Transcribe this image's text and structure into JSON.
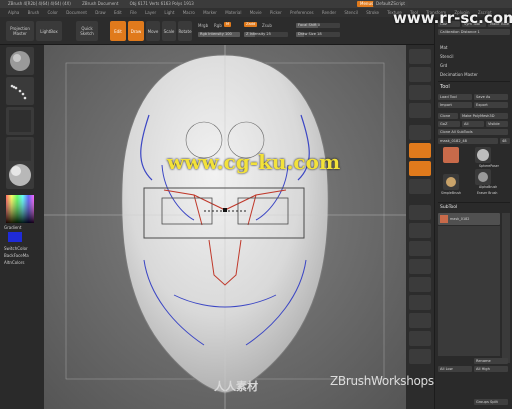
{
  "titlebar": {
    "items": [
      "ZBrush 4[R2b] 4(64) 4(64) (4X)",
      "ZBrush Document",
      "Obj 6171 Verts 6163 Polys 1913"
    ],
    "menu_button": "Menus",
    "script_button": "DefaultZScript"
  },
  "menubar": {
    "items": [
      "Alpha",
      "Brush",
      "Color",
      "Document",
      "Draw",
      "Edit",
      "File",
      "Layer",
      "Light",
      "Macro",
      "Marker",
      "Material",
      "Movie",
      "Picker",
      "Preferences",
      "Render",
      "Stencil",
      "Stroke",
      "Texture",
      "Tool",
      "Transform",
      "Zplugin",
      "Zscript"
    ]
  },
  "toolbar": {
    "projection_master": "Projection Master",
    "lightbox": "LightBox",
    "quick_sketch": "Quick Sketch",
    "edit": "Edit",
    "draw": "Draw",
    "move": "Move",
    "scale": "Scale",
    "rotate": "Rotate",
    "mrgb": "Mrgb",
    "rgb": "Rgb",
    "m": "M",
    "rgb_intensity": "Rgb Intensity 100",
    "zadd": "Zadd",
    "zsub": "Zsub",
    "z_intensity": "Z Intensity 25",
    "focal_shift": "Focal Shift 0",
    "draw_size": "Draw Size 18",
    "rgb_intensity_value": 100,
    "z_intensity_value": 25,
    "focal_shift_value": 0,
    "draw_size_value": 18
  },
  "left_tray": {
    "gradient": "Gradient",
    "switch_color": "SwitchColor",
    "backface_mask": "BackFaceMa",
    "alternate": "AltnColors"
  },
  "canvas": {
    "watermark": "www.cg-ku.com",
    "brand": "ZBrushWorkshops",
    "site": "www.rr-sc.com",
    "cn_logo": "人人素材"
  },
  "palette": {
    "top_buttons": [
      "Goz",
      "Load",
      "Save"
    ],
    "row1": [
      "Goz",
      "Sym Tool",
      "Make Tube"
    ],
    "calibration": "Calibration Distance 1",
    "sections": [
      "Mat",
      "Stencil",
      "Grd",
      "Decimation Master"
    ],
    "tool_header": "Tool",
    "load_tool": "Load Tool",
    "save_as": "Save As",
    "import": "Import",
    "export": "Export",
    "clone": "Clone",
    "make_polymesh": "Make PolyMesh3D",
    "goz": "GoZ",
    "all": "All",
    "visible": "Visible",
    "clone_all_subtools": "Clone All SubTools",
    "tool_name": "mask_0182_48",
    "tool_count": "48",
    "thumb_labels": [
      "SimpleBrush",
      "Eraser Brush",
      "SpherePoser",
      "AlphaBrush"
    ],
    "subtool_header": "SubTool",
    "subtool_name": "mask_0182",
    "rename": "Rename",
    "all_low": "All Low",
    "all_high": "All High",
    "groups_split": "Groups Split"
  },
  "colors": {
    "accent": "#e07a1c",
    "panel": "#2a2a2a",
    "canvas": "#6f6f6f",
    "watermark": "#f3e23a"
  }
}
